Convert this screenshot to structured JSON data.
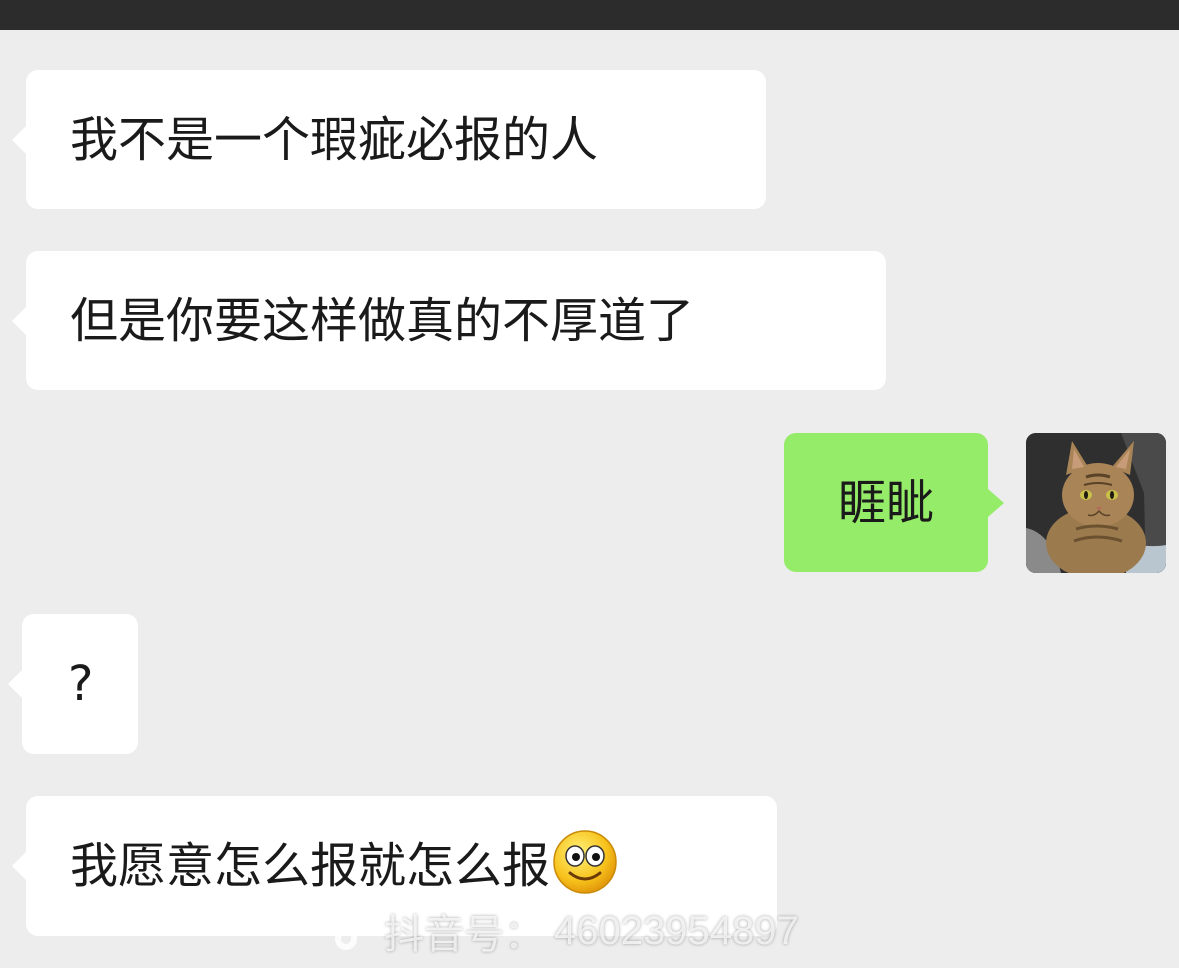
{
  "messages": [
    {
      "side": "left",
      "text": "我不是一个瑕疵必报的人"
    },
    {
      "side": "left",
      "text": "但是你要这样做真的不厚道了"
    },
    {
      "side": "right",
      "text": "睚眦"
    },
    {
      "side": "left",
      "text": "?"
    },
    {
      "side": "left",
      "text": "我愿意怎么报就怎么报",
      "emoji": "smile-face-emoji"
    }
  ],
  "watermark": {
    "icon": "tiktok-logo-icon",
    "label": "抖音号：",
    "id": "46023954897"
  },
  "colors": {
    "background": "#ededed",
    "incoming_bubble": "#ffffff",
    "outgoing_bubble": "#95ec69",
    "top_bar": "#2c2c2c"
  },
  "avatar": {
    "icon": "cat-avatar"
  }
}
